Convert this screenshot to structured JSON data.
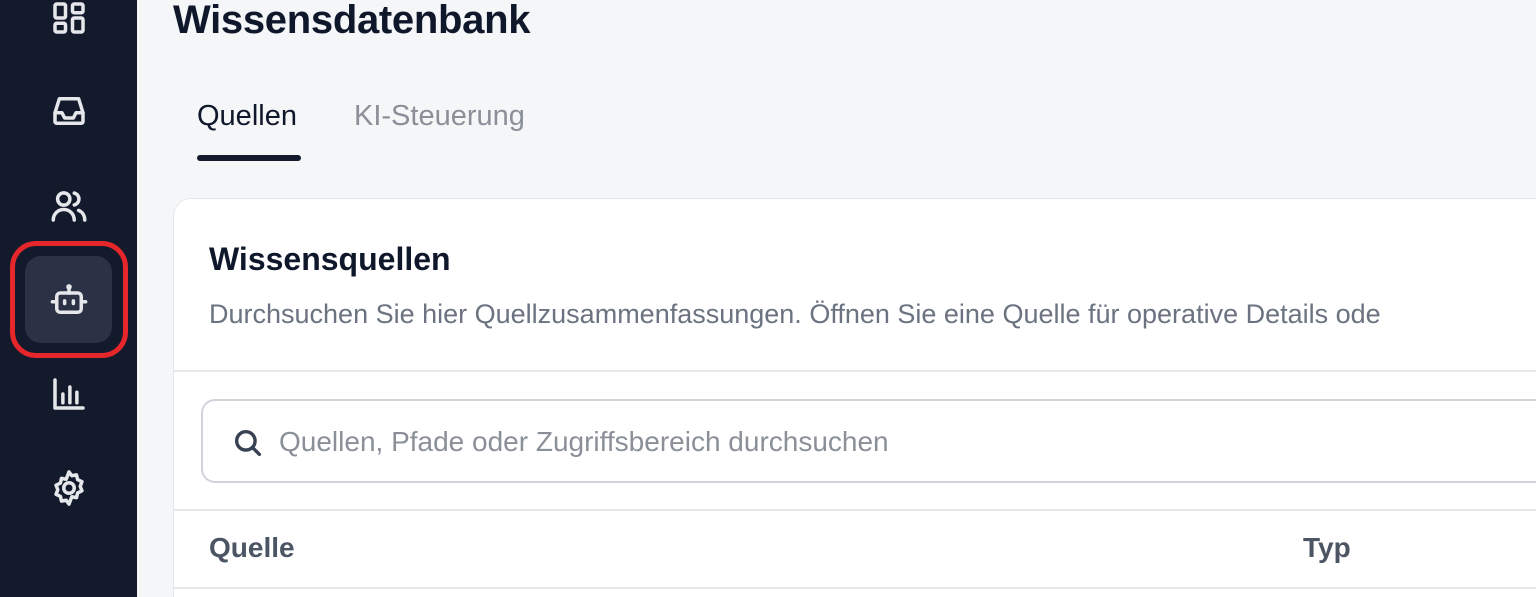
{
  "sidebar": {
    "items": [
      {
        "icon": "dashboard-icon"
      },
      {
        "icon": "inbox-icon"
      },
      {
        "icon": "users-icon"
      },
      {
        "icon": "bot-icon",
        "active": true
      },
      {
        "icon": "bar-chart-icon"
      },
      {
        "icon": "gear-icon"
      }
    ]
  },
  "header": {
    "title": "Wissensdatenbank"
  },
  "tabs": [
    {
      "label": "Quellen",
      "active": true
    },
    {
      "label": "KI-Steuerung",
      "active": false
    }
  ],
  "card": {
    "title": "Wissensquellen",
    "description": "Durchsuchen Sie hier Quellzusammenfassungen. Öffnen Sie eine Quelle für operative Details ode",
    "search": {
      "placeholder": "Quellen, Pfade oder Zugriffsbereich durchsuchen",
      "value": ""
    },
    "table": {
      "columns": [
        "Quelle",
        "Typ"
      ]
    }
  },
  "colors": {
    "sidebar_bg": "#131a2b",
    "active_item_bg": "#2b3245",
    "highlight_ring": "#e5262b",
    "page_bg": "#f5f6f8"
  }
}
